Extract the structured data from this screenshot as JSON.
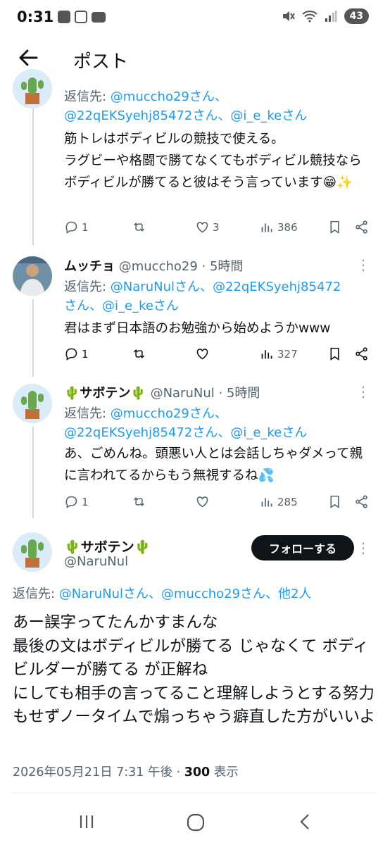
{
  "status_bar": {
    "time": "0:31",
    "battery": "43"
  },
  "header": {
    "title": "ポスト"
  },
  "tweets": [
    {
      "reply_prefix": "返信先: ",
      "reply_mentions": "@muccho29さん、",
      "reply_mentions2": "@22qEKSyehj85472さん、@i_e_keさん",
      "body": "筋トレはボディビルの競技で使える。\nラグビーや格闘で勝てなくてもボディビル競技ならボディビルが勝てると彼はそう言っています😁✨",
      "replies": "1",
      "retweets": "",
      "likes": "3",
      "views": "386"
    },
    {
      "name": "ムッチョ",
      "handle": "@muccho29 · 5時間",
      "reply_prefix": "返信先: ",
      "reply_mentions": "@NaruNulさん、@22qEKSyehj85472",
      "reply_mentions2": "さん、@i_e_keさん",
      "body": "君はまず日本語のお勉強から始めようかwww",
      "replies": "1",
      "retweets": "",
      "likes": "",
      "views": "327"
    },
    {
      "name": "🌵サボテン🌵",
      "handle": "@NaruNul · 5時間",
      "reply_prefix": "返信先: ",
      "reply_mentions": "@muccho29さん、",
      "reply_mentions2": "@22qEKSyehj85472さん、@i_e_keさん",
      "body": "あ、ごめんね。頭悪い人とは会話しちゃダメって親に言われてるからもう無視するね💦",
      "replies": "1",
      "retweets": "",
      "likes": "",
      "views": "285"
    }
  ],
  "main_tweet": {
    "name": "🌵サボテン🌵",
    "handle": "@NaruNul",
    "follow_label": "フォローする",
    "reply_prefix": "返信先: ",
    "reply_mentions": "@NaruNulさん、@muccho29さん、他2人",
    "body": "あー誤字ってたんかすまんな\n最後の文はボディビルが勝てる じゃなくて ボディビルダーが勝てる が正解ね\nにしても相手の言ってること理解しようとする努力もせずノータイムで煽っちゃう癖直した方がいいよ",
    "timestamp": "2026年05月21日 7:31 午後 · ",
    "view_count": "300",
    "view_label": " 表示"
  },
  "colors": {
    "accent": "#1d9bf0",
    "text": "#0f1419",
    "muted": "#536471",
    "line": "#cfd9de"
  },
  "icons": [
    "back-arrow-icon",
    "reply-icon",
    "retweet-icon",
    "like-icon",
    "views-icon",
    "bookmark-icon",
    "share-icon",
    "more-icon"
  ]
}
